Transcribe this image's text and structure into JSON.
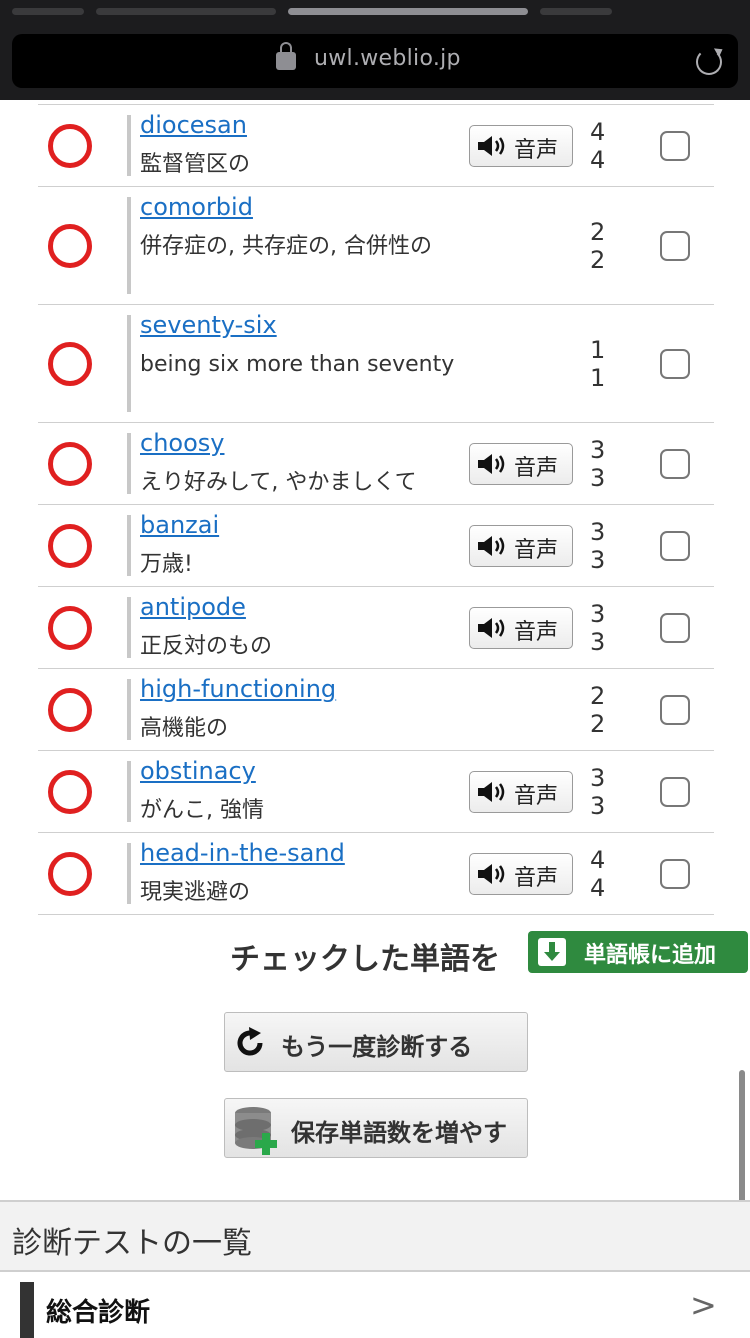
{
  "browser": {
    "url": "uwl.weblio.jp"
  },
  "audio_label": "音声",
  "words": [
    {
      "word": "diocesan",
      "definition": "監督管区の",
      "has_audio": true,
      "score": "4 4",
      "correct": true,
      "checked": false
    },
    {
      "word": "comorbid",
      "definition": "併存症の, 共存症の, 合併性の",
      "has_audio": false,
      "score": "2 2",
      "correct": true,
      "checked": false
    },
    {
      "word": "seventy-six",
      "definition": "being six more than seventy",
      "has_audio": false,
      "score": "1 1",
      "correct": true,
      "checked": false
    },
    {
      "word": "choosy",
      "definition": "えり好みして, やかましくて",
      "has_audio": true,
      "score": "3 3",
      "correct": true,
      "checked": false
    },
    {
      "word": "banzai",
      "definition": "万歳!",
      "has_audio": true,
      "score": "3 3",
      "correct": true,
      "checked": false
    },
    {
      "word": "antipode",
      "definition": "正反対のもの",
      "has_audio": true,
      "score": "3 3",
      "correct": true,
      "checked": false
    },
    {
      "word": "high-functioning",
      "definition": "高機能の",
      "has_audio": false,
      "score": "2 2",
      "correct": true,
      "checked": false
    },
    {
      "word": "obstinacy",
      "definition": "がんこ, 強情",
      "has_audio": true,
      "score": "3 3",
      "correct": true,
      "checked": false
    },
    {
      "word": "head-in-the-sand",
      "definition": "現実逃避の",
      "has_audio": true,
      "score": "4 4",
      "correct": true,
      "checked": false
    }
  ],
  "actions": {
    "checked_words_label": "チェックした単語を",
    "add_to_wordbook": "単語帳に追加",
    "retry": "もう一度診断する",
    "increase_saved": "保存単語数を増やす"
  },
  "section": {
    "title": "診断テストの一覧",
    "items": [
      {
        "label": "総合診断",
        "chevron": ">"
      }
    ]
  },
  "colors": {
    "link": "#1a6fc4",
    "correct_ring": "#e02020",
    "add_button": "#2f8a3f"
  }
}
